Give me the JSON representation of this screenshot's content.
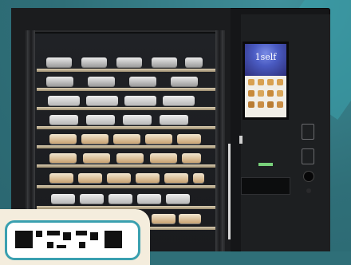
{
  "scene": {
    "description_free": "",
    "machine": {
      "screen_logo_text": "1self"
    }
  },
  "colors": {
    "background": "#2f6f78",
    "machine_body": "#151618",
    "badge_bg": "#f4eddd",
    "qr_border": "#3aa0b0",
    "led_green": "#78d07a"
  },
  "icons": {
    "qr": "qr-code-icon"
  }
}
